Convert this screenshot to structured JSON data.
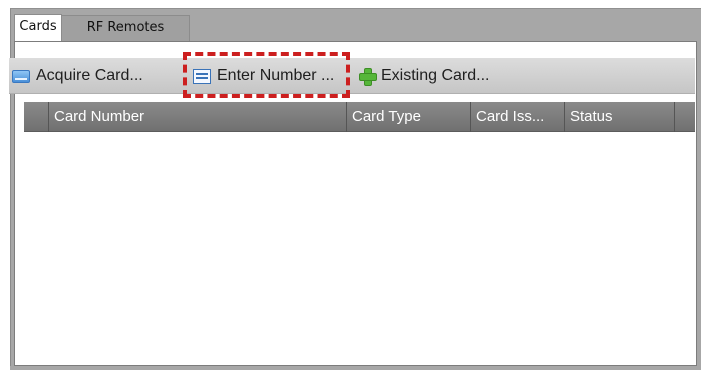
{
  "tabs": [
    {
      "label": "Cards",
      "active": true
    },
    {
      "label": "RF Remotes",
      "active": false
    }
  ],
  "toolbar": {
    "acquire_label": "Acquire Card...",
    "acquire_icon": "card-icon",
    "enter_label": "Enter Number ...",
    "enter_icon": "form-icon",
    "existing_label": "Existing Card...",
    "existing_icon": "plus-icon"
  },
  "grid": {
    "columns": [
      "",
      "Card Number",
      "Card Type",
      "Card Iss...",
      "Status",
      ""
    ],
    "rows": []
  },
  "colors": {
    "highlight": "#cc1f1f",
    "header_bg": "#7a7a7a",
    "frame_bg": "#a7a7a7"
  }
}
